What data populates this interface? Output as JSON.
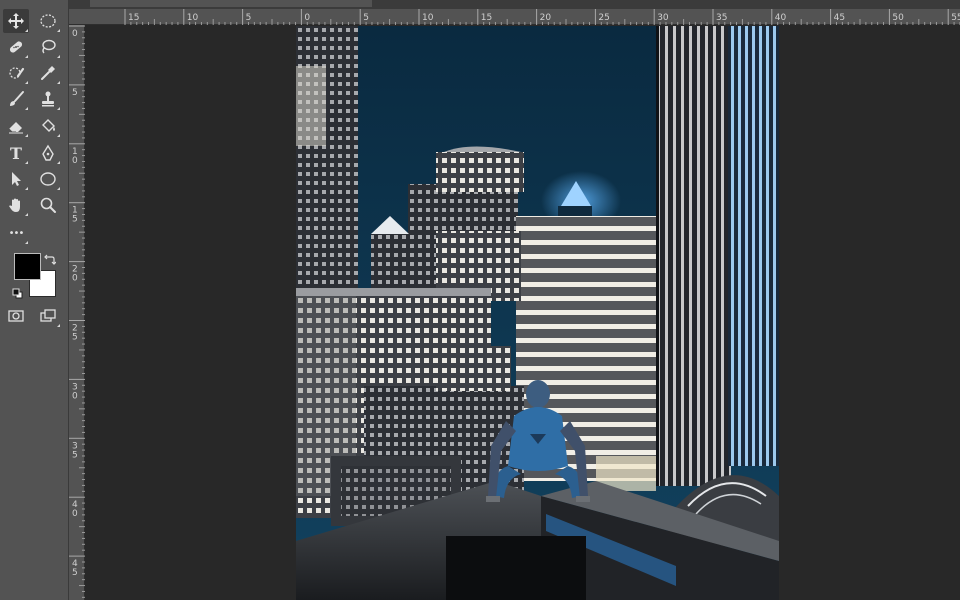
{
  "rulers": {
    "horizontal": [
      "15",
      "10",
      "5",
      "0",
      "5",
      "10",
      "15",
      "20",
      "25",
      "30",
      "35",
      "40",
      "45",
      "50",
      "55"
    ],
    "vertical": [
      [
        "0"
      ],
      [
        "5"
      ],
      [
        "1",
        "0"
      ],
      [
        "1",
        "5"
      ],
      [
        "2",
        "0"
      ],
      [
        "2",
        "5"
      ],
      [
        "3",
        "0"
      ],
      [
        "3",
        "5"
      ],
      [
        "4",
        "0"
      ],
      [
        "4",
        "5"
      ]
    ]
  },
  "tools": {
    "text_tool_glyph": "T",
    "more_glyph": "•••"
  },
  "colors": {
    "foreground": "#000000",
    "background": "#ffffff",
    "ui_panel": "#535353",
    "canvas_bg": "#282828",
    "sky": "#0b3149",
    "accent_blue": "#2a6fb0"
  },
  "document": {
    "image": "night-city-rooftop-photo"
  }
}
